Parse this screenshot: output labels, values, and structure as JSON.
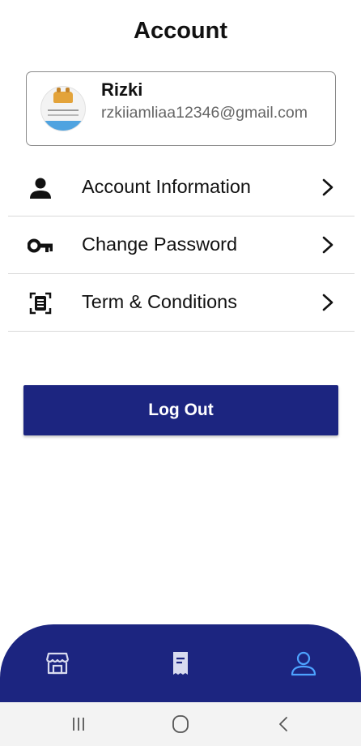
{
  "header": {
    "title": "Account"
  },
  "profile": {
    "name": "Rizki",
    "email": "rzkiiamliaa12346@gmail.com",
    "avatar_icon": "mascot-avatar"
  },
  "menu": {
    "items": [
      {
        "label": "Account Information",
        "icon": "person-icon"
      },
      {
        "label": "Change Password",
        "icon": "key-icon"
      },
      {
        "label": "Term & Conditions",
        "icon": "document-scan-icon"
      }
    ]
  },
  "logout": {
    "label": "Log Out"
  },
  "bottom_nav": {
    "items": [
      {
        "name": "store",
        "icon": "store-icon",
        "active": false
      },
      {
        "name": "receipt",
        "icon": "receipt-icon",
        "active": false
      },
      {
        "name": "account",
        "icon": "user-icon",
        "active": true
      }
    ]
  },
  "colors": {
    "primary": "#1c2580",
    "active_icon": "#4da3ff",
    "inactive_icon": "#d8dbef"
  }
}
